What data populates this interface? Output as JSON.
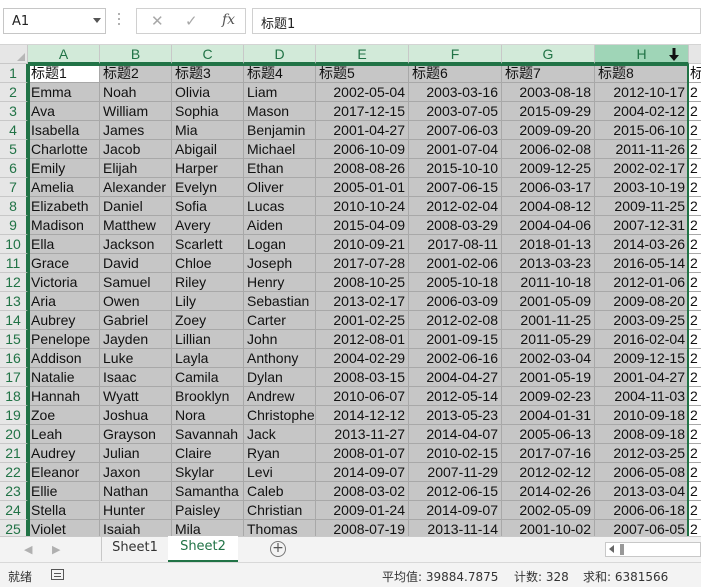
{
  "formula_bar": {
    "name_box": "A1",
    "cancel_symbol": "✕",
    "enter_symbol": "✓",
    "fx_symbol": "fx",
    "content": "标题1"
  },
  "columns": [
    "A",
    "B",
    "C",
    "D",
    "E",
    "F",
    "G",
    "H"
  ],
  "active_column": "H",
  "row_numbers": [
    "1",
    "2",
    "3",
    "4",
    "5",
    "6",
    "7",
    "8",
    "9",
    "10",
    "11",
    "12",
    "13",
    "14",
    "15",
    "16",
    "17",
    "18",
    "19",
    "20",
    "21",
    "22",
    "23",
    "24",
    "25"
  ],
  "rows": [
    [
      "标题1",
      "标题2",
      "标题3",
      "标题4",
      "标题5",
      "标题6",
      "标题7",
      "标题8",
      "标"
    ],
    [
      "Emma",
      "Noah",
      "Olivia",
      "Liam",
      "2002-05-04",
      "2003-03-16",
      "2003-08-18",
      "2012-10-17",
      "2"
    ],
    [
      "Ava",
      "William",
      "Sophia",
      "Mason",
      "2017-12-15",
      "2003-07-05",
      "2015-09-29",
      "2004-02-12",
      "2"
    ],
    [
      "Isabella",
      "James",
      "Mia",
      "Benjamin",
      "2001-04-27",
      "2007-06-03",
      "2009-09-20",
      "2015-06-10",
      "2"
    ],
    [
      "Charlotte",
      "Jacob",
      "Abigail",
      "Michael",
      "2006-10-09",
      "2001-07-04",
      "2006-02-08",
      "2011-11-26",
      "2"
    ],
    [
      "Emily",
      "Elijah",
      "Harper",
      "Ethan",
      "2008-08-26",
      "2015-10-10",
      "2009-12-25",
      "2002-02-17",
      "2"
    ],
    [
      "Amelia",
      "Alexander",
      "Evelyn",
      "Oliver",
      "2005-01-01",
      "2007-06-15",
      "2006-03-17",
      "2003-10-19",
      "2"
    ],
    [
      "Elizabeth",
      "Daniel",
      "Sofia",
      "Lucas",
      "2010-10-24",
      "2012-02-04",
      "2004-08-12",
      "2009-11-25",
      "2"
    ],
    [
      "Madison",
      "Matthew",
      "Avery",
      "Aiden",
      "2015-04-09",
      "2008-03-29",
      "2004-04-06",
      "2007-12-31",
      "2"
    ],
    [
      "Ella",
      "Jackson",
      "Scarlett",
      "Logan",
      "2010-09-21",
      "2017-08-11",
      "2018-01-13",
      "2014-03-26",
      "2"
    ],
    [
      "Grace",
      "David",
      "Chloe",
      "Joseph",
      "2017-07-28",
      "2001-02-06",
      "2013-03-23",
      "2016-05-14",
      "2"
    ],
    [
      "Victoria",
      "Samuel",
      "Riley",
      "Henry",
      "2008-10-25",
      "2005-10-18",
      "2011-10-18",
      "2012-01-06",
      "2"
    ],
    [
      "Aria",
      "Owen",
      "Lily",
      "Sebastian",
      "2013-02-17",
      "2006-03-09",
      "2001-05-09",
      "2009-08-20",
      "2"
    ],
    [
      "Aubrey",
      "Gabriel",
      "Zoey",
      "Carter",
      "2001-02-25",
      "2012-02-08",
      "2001-11-25",
      "2003-09-25",
      "2"
    ],
    [
      "Penelope",
      "Jayden",
      "Lillian",
      "John",
      "2012-08-01",
      "2001-09-15",
      "2011-05-29",
      "2016-02-04",
      "2"
    ],
    [
      "Addison",
      "Luke",
      "Layla",
      "Anthony",
      "2004-02-29",
      "2002-06-16",
      "2002-03-04",
      "2009-12-15",
      "2"
    ],
    [
      "Natalie",
      "Isaac",
      "Camila",
      "Dylan",
      "2008-03-15",
      "2004-04-27",
      "2001-05-19",
      "2001-04-27",
      "2"
    ],
    [
      "Hannah",
      "Wyatt",
      "Brooklyn",
      "Andrew",
      "2010-06-07",
      "2012-05-14",
      "2009-02-23",
      "2004-11-03",
      "2"
    ],
    [
      "Zoe",
      "Joshua",
      "Nora",
      "Christophe",
      "2014-12-12",
      "2013-05-23",
      "2004-01-31",
      "2010-09-18",
      "2"
    ],
    [
      "Leah",
      "Grayson",
      "Savannah",
      "Jack",
      "2013-11-27",
      "2014-04-07",
      "2005-06-13",
      "2008-09-18",
      "2"
    ],
    [
      "Audrey",
      "Julian",
      "Claire",
      "Ryan",
      "2008-01-07",
      "2010-02-15",
      "2017-07-16",
      "2012-03-25",
      "2"
    ],
    [
      "Eleanor",
      "Jaxon",
      "Skylar",
      "Levi",
      "2014-09-07",
      "2007-11-29",
      "2012-02-12",
      "2006-05-08",
      "2"
    ],
    [
      "Ellie",
      "Nathan",
      "Samantha",
      "Caleb",
      "2008-03-02",
      "2012-06-15",
      "2014-02-26",
      "2013-03-04",
      "2"
    ],
    [
      "Stella",
      "Hunter",
      "Paisley",
      "Christian",
      "2009-01-24",
      "2014-09-07",
      "2002-05-09",
      "2006-06-18",
      "2"
    ],
    [
      "Violet",
      "Isaiah",
      "Mila",
      "Thomas",
      "2008-07-19",
      "2013-11-14",
      "2001-10-02",
      "2007-06-05",
      "2"
    ]
  ],
  "sheet_tabs": {
    "prev": "◀",
    "next": "▶",
    "sheet1": "Sheet1",
    "sheet2": "Sheet2",
    "add": "+"
  },
  "status_bar": {
    "mode": "就绪",
    "average": "平均值: 39884.7875",
    "count": "计数: 328",
    "sum": "求和: 6381566"
  },
  "colors": {
    "accent": "#217346",
    "selection_fill": "#c6c6c6",
    "header_selected": "#d2ead9"
  }
}
